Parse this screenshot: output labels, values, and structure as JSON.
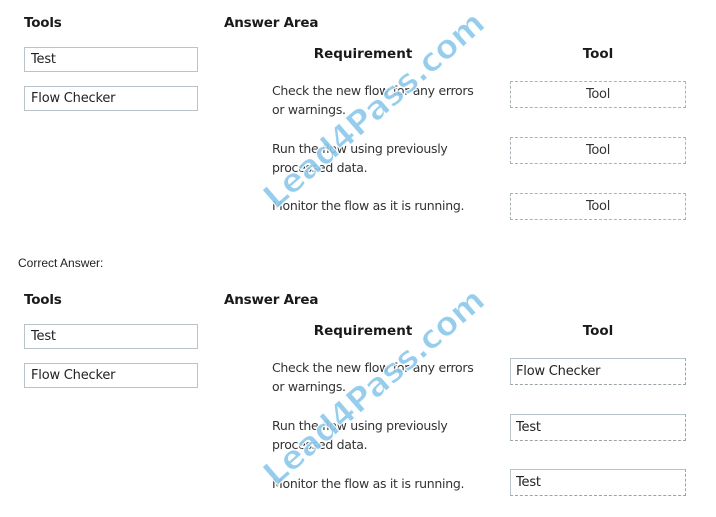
{
  "question": {
    "tools_heading": "Tools",
    "answer_area_heading": "Answer Area",
    "tools": [
      {
        "label": "Test"
      },
      {
        "label": "Flow Checker"
      }
    ],
    "columns": {
      "requirement": "Requirement",
      "tool": "Tool"
    },
    "rows": [
      {
        "requirement": "Check the new flow for any errors or warnings.",
        "answer": "Tool"
      },
      {
        "requirement": "Run the flow using previously processed data.",
        "answer": "Tool"
      },
      {
        "requirement": "Monitor the flow as it is running.",
        "answer": "Tool"
      }
    ]
  },
  "correct_answer_label": "Correct Answer:",
  "answer": {
    "tools_heading": "Tools",
    "answer_area_heading": "Answer Area",
    "tools": [
      {
        "label": "Test"
      },
      {
        "label": "Flow Checker"
      }
    ],
    "columns": {
      "requirement": "Requirement",
      "tool": "Tool"
    },
    "rows": [
      {
        "requirement": "Check the new flow for any errors or warnings.",
        "answer": "Flow Checker"
      },
      {
        "requirement": "Run the flow using previously processed data.",
        "answer": "Test"
      },
      {
        "requirement": "Monitor the flow as it is running.",
        "answer": "Test"
      }
    ]
  },
  "watermark": {
    "text": "Lead4Pass.com",
    "color": "#8cc8ea"
  }
}
